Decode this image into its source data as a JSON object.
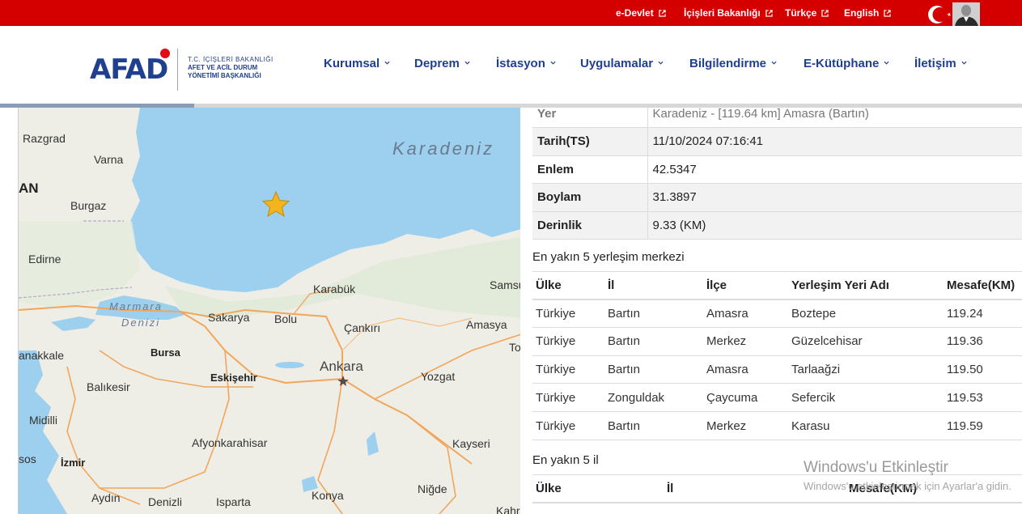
{
  "topbar": {
    "links": [
      {
        "label": "e-Devlet"
      },
      {
        "label": "İçişleri Bakanlığı"
      },
      {
        "label": "Türkçe"
      },
      {
        "label": "English"
      }
    ]
  },
  "logo": {
    "brand": "AFAD",
    "line1": "T.C. İÇİŞLERİ BAKANLIĞI",
    "line2": "AFET VE ACİL DURUM",
    "line3": "YÖNETİMİ BAŞKANLIĞI"
  },
  "nav": [
    {
      "label": "Kurumsal"
    },
    {
      "label": "Deprem"
    },
    {
      "label": "İstasyon"
    },
    {
      "label": "Uygulamalar"
    },
    {
      "label": "Bilgilendirme"
    },
    {
      "label": "E-Kütüphane"
    },
    {
      "label": "İletişim"
    }
  ],
  "progress": {
    "fraction": 0.19
  },
  "map": {
    "sea_label": "Karadeniz",
    "marmara_1": "Marmara",
    "marmara_2": "Denizi",
    "places": {
      "razgrad": "Razgrad",
      "varna": "Varna",
      "an": "AN",
      "burgaz": "Burgaz",
      "edirne": "Edirne",
      "karabuk": "Karabük",
      "samsun": "Samsu",
      "sakarya": "Sakarya",
      "bolu": "Bolu",
      "cankiri": "Çankırı",
      "amasya": "Amasya",
      "anakkale": "anakkale",
      "bursa": "Bursa",
      "to": "To",
      "ankara": "Ankara",
      "eskisehir": "Eskişehir",
      "yozgat": "Yozgat",
      "balikesir": "Balıkesir",
      "midilli": "Midilli",
      "afyon": "Afyonkarahisar",
      "kayseri": "Kayseri",
      "sos": "sos",
      "izmir": "İzmir",
      "aydin": "Aydın",
      "denizli": "Denizli",
      "isparta": "Isparta",
      "konya": "Konya",
      "nigde": "Niğde",
      "kahr": "Kahr"
    }
  },
  "details": {
    "rows": [
      {
        "key": "Yer",
        "value": "Karadeniz - [119.64 km] Amasra (Bartın)"
      },
      {
        "key": "Tarih(TS)",
        "value": "11/10/2024 07:16:41"
      },
      {
        "key": "Enlem",
        "value": "42.5347"
      },
      {
        "key": "Boylam",
        "value": "31.3897"
      },
      {
        "key": "Derinlik",
        "value": "9.33 (KM)"
      }
    ]
  },
  "nearest_settlements": {
    "title": "En yakın 5 yerleşim merkezi",
    "headers": [
      "Ülke",
      "İl",
      "İlçe",
      "Yerleşim Yeri Adı",
      "Mesafe(KM)"
    ],
    "rows": [
      [
        "Türkiye",
        "Bartın",
        "Amasra",
        "Boztepe",
        "119.24"
      ],
      [
        "Türkiye",
        "Bartın",
        "Merkez",
        "Güzelcehisar",
        "119.36"
      ],
      [
        "Türkiye",
        "Bartın",
        "Amasra",
        "Tarlaağzi",
        "119.50"
      ],
      [
        "Türkiye",
        "Zonguldak",
        "Çaycuma",
        "Sefercik",
        "119.53"
      ],
      [
        "Türkiye",
        "Bartın",
        "Merkez",
        "Karasu",
        "119.59"
      ]
    ]
  },
  "nearest_provinces": {
    "title": "En yakın 5 il",
    "headers": [
      "Ülke",
      "İl",
      "Mesafe(KM)"
    ]
  },
  "watermark": {
    "title": "Windows'u Etkinleştir",
    "subtitle": "Windows'u etkinleştirmek için Ayarlar'a gidin."
  },
  "colors": {
    "topbar": "#d40000",
    "brand_blue": "#1f3f8f",
    "sea": "#9dcfee",
    "land": "#eeeee6",
    "epicenter": "#f2b51d"
  }
}
